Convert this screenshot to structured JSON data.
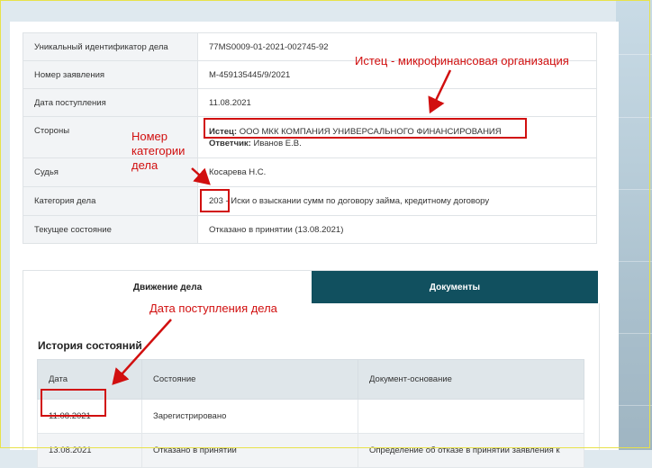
{
  "case_info": {
    "rows": [
      {
        "key": "Уникальный идентификатор дела",
        "value": "77MS0009-01-2021-002745-92"
      },
      {
        "key": "Номер заявления",
        "value": "М-459135445/9/2021"
      },
      {
        "key": "Дата поступления",
        "value": "11.08.2021"
      },
      {
        "key": "Стороны"
      },
      {
        "key": "Судья",
        "value": "Косарева Н.С."
      },
      {
        "key": "Категория дела"
      },
      {
        "key": "Текущее состояние",
        "value": "Отказано в принятии (13.08.2021)"
      }
    ],
    "plaintiff_label": "Истец:",
    "plaintiff": "ООО МКК КОМПАНИЯ УНИВЕРСАЛЬНОГО ФИНАНСИРОВАНИЯ",
    "defendant_label": "Ответчик:",
    "defendant": "Иванов Е.В.",
    "category_code": "203",
    "category_text": "- Иски о взыскании сумм по договору займа, кредитному договору"
  },
  "tabs": {
    "movement": "Движение дела",
    "documents": "Документы"
  },
  "history": {
    "title": "История состояний",
    "columns": [
      "Дата",
      "Состояние",
      "Документ-основание"
    ],
    "rows": [
      [
        "11.08.2021",
        "Зарегистрировано",
        ""
      ],
      [
        "13.08.2021",
        "Отказано в принятии",
        "Определение об отказе в принятии заявления к"
      ]
    ]
  },
  "annotations": {
    "plaintiff_note": "Истец - микрофинансовая организация",
    "category_note_lines": [
      "Номер",
      "категории",
      "дела"
    ],
    "date_note": "Дата поступления дела"
  },
  "colors": {
    "annotation": "#d10f0f",
    "tab_inactive": "#11505f"
  }
}
